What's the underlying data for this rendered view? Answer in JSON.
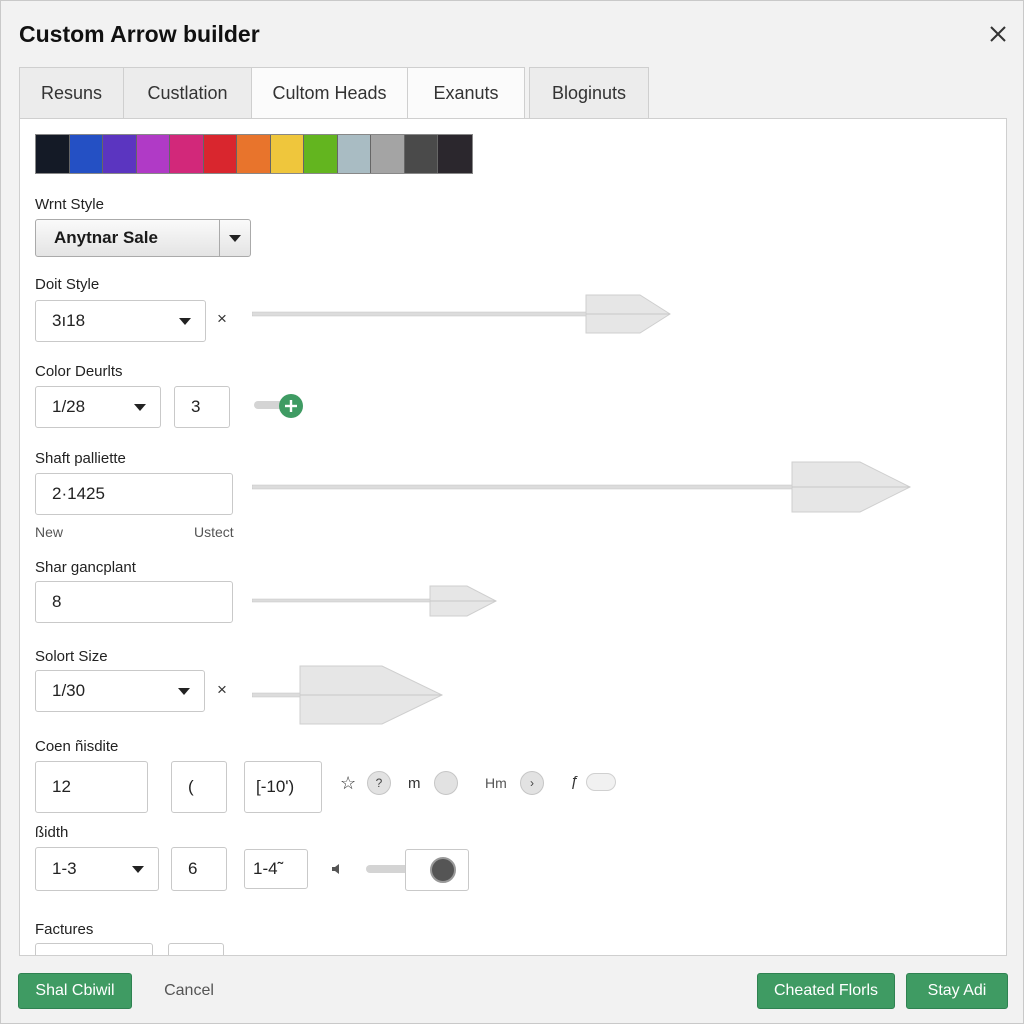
{
  "dialog": {
    "title": "Custom Arrow builder"
  },
  "tabs": [
    {
      "label": "Resuns"
    },
    {
      "label": "Custlation"
    },
    {
      "label": "Cultom Heads"
    },
    {
      "label": "Exanuts"
    },
    {
      "label": "Bloginuts"
    }
  ],
  "palette": [
    "#141a26",
    "#2450c4",
    "#5b35c0",
    "#b03ac6",
    "#d2287a",
    "#d9262e",
    "#e8742c",
    "#efc63c",
    "#63b51f",
    "#a9bcc3",
    "#a4a4a4",
    "#4a4a4a",
    "#2b272d"
  ],
  "form": {
    "wrist_style": {
      "label": "Wrnt Style",
      "value": "Anytnar Sale"
    },
    "doit_style": {
      "label": "Doit Style",
      "value": "3ı18",
      "x": "×"
    },
    "color_deurits": {
      "label": "Color Deurlts",
      "value": "1/28",
      "value2": "3"
    },
    "shaft_palette": {
      "label": "Shaft palliette",
      "value": "2·1425",
      "left_caption": "New",
      "right_caption": "Ustect"
    },
    "shar_gancplant": {
      "label": "Shar gancplant",
      "value": "8"
    },
    "solort_size": {
      "label": "Solort Size",
      "value": "1/30",
      "x": "×"
    },
    "coen_misdite": {
      "label": "Coen ñisdite",
      "value1": "12",
      "value2": "(",
      "value3": "[-10')",
      "icon_q": "?",
      "text_m": "m",
      "text_hm": "Hm",
      "icon_s": "ƒ"
    },
    "bidth": {
      "label": "ßidth",
      "value1": "1-3",
      "value2": "6",
      "value3": "1-4̃"
    },
    "factures": {
      "label": "Factures"
    }
  },
  "footer": {
    "left_button": "Shal Cbiwil",
    "cancel": "Cancel",
    "right_button1": "Cheated Florls",
    "right_button2": "Stay Adi"
  }
}
